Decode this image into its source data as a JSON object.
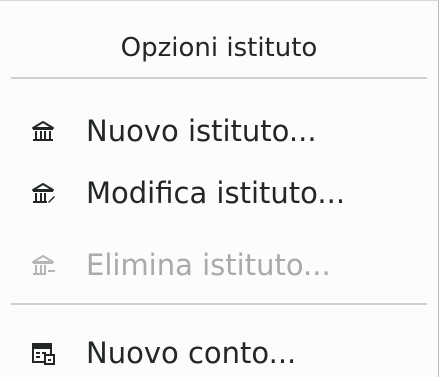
{
  "menu": {
    "title": "Opzioni istituto",
    "items": [
      {
        "label": "Nuovo istituto...",
        "icon": "bank-new-icon",
        "enabled": true
      },
      {
        "label": "Modifica istituto...",
        "icon": "bank-edit-icon",
        "enabled": true
      },
      {
        "label": "Elimina istituto...",
        "icon": "bank-delete-icon",
        "enabled": false
      },
      {
        "label": "Nuovo conto...",
        "icon": "account-new-icon",
        "enabled": true
      }
    ]
  },
  "colors": {
    "text": "#232627",
    "text_disabled": "#a8aaab",
    "background": "#fcfcfc",
    "separator": "#cfcfcf"
  }
}
